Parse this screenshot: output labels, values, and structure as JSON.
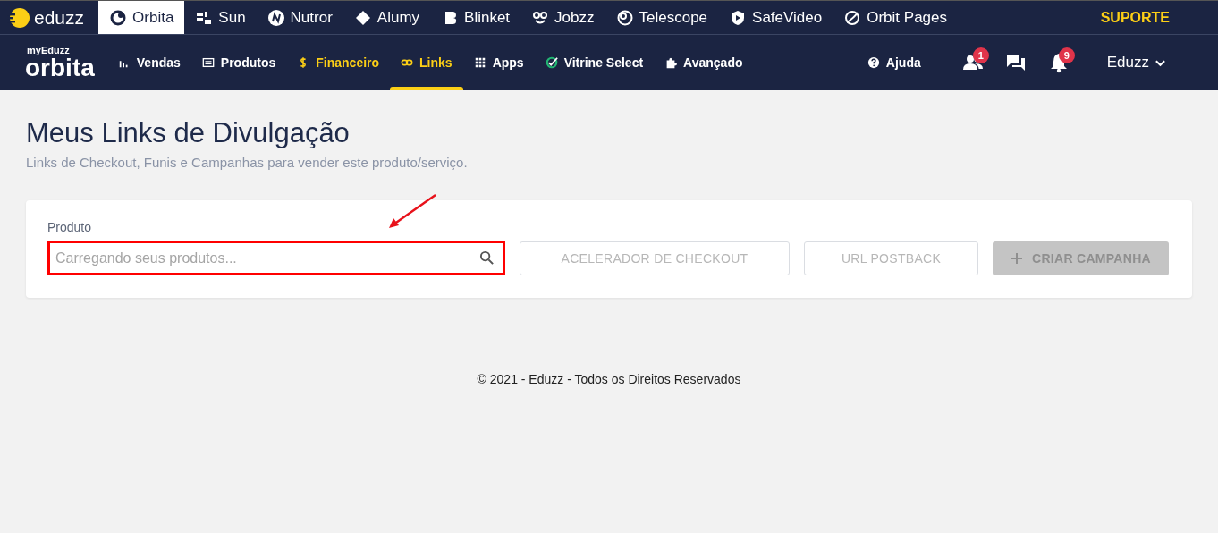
{
  "topbar": {
    "brand": "eduzz",
    "apps": [
      {
        "label": "Orbita",
        "selected": true
      },
      {
        "label": "Sun",
        "selected": false
      },
      {
        "label": "Nutror",
        "selected": false
      },
      {
        "label": "Alumy",
        "selected": false
      },
      {
        "label": "Blinket",
        "selected": false
      },
      {
        "label": "Jobzz",
        "selected": false
      },
      {
        "label": "Telescope",
        "selected": false
      },
      {
        "label": "SafeVideo",
        "selected": false
      },
      {
        "label": "Orbit Pages",
        "selected": false
      }
    ],
    "support": "SUPORTE"
  },
  "navbar": {
    "logo_small": "myEduzz",
    "logo": "orbita",
    "items": [
      {
        "label": "Vendas",
        "selected": false,
        "highlighted": false
      },
      {
        "label": "Produtos",
        "selected": false,
        "highlighted": false
      },
      {
        "label": "Financeiro",
        "selected": false,
        "highlighted": true
      },
      {
        "label": "Links",
        "selected": true,
        "highlighted": true
      },
      {
        "label": "Apps",
        "selected": false,
        "highlighted": false
      },
      {
        "label": "Vitrine Select",
        "selected": false,
        "highlighted": false
      },
      {
        "label": "Avançado",
        "selected": false,
        "highlighted": false
      }
    ],
    "help": "Ajuda",
    "people_badge": "1",
    "notifications_badge": "9",
    "user": "Eduzz"
  },
  "page": {
    "title": "Meus Links de Divulgação",
    "subtitle": "Links de Checkout, Funis e Campanhas para vender este produto/serviço."
  },
  "form": {
    "label": "Produto",
    "placeholder": "Carregando seus produtos...",
    "highlighted": true,
    "buttons": [
      {
        "label": "ACELERADOR DE CHECKOUT",
        "kind": "outline",
        "disabled": true
      },
      {
        "label": "URL POSTBACK",
        "kind": "outline",
        "disabled": true
      },
      {
        "label": "CRIAR CAMPANHA",
        "kind": "filled",
        "disabled": true
      }
    ]
  },
  "footer": "© 2021 - Eduzz - Todos os Direitos Reservados"
}
